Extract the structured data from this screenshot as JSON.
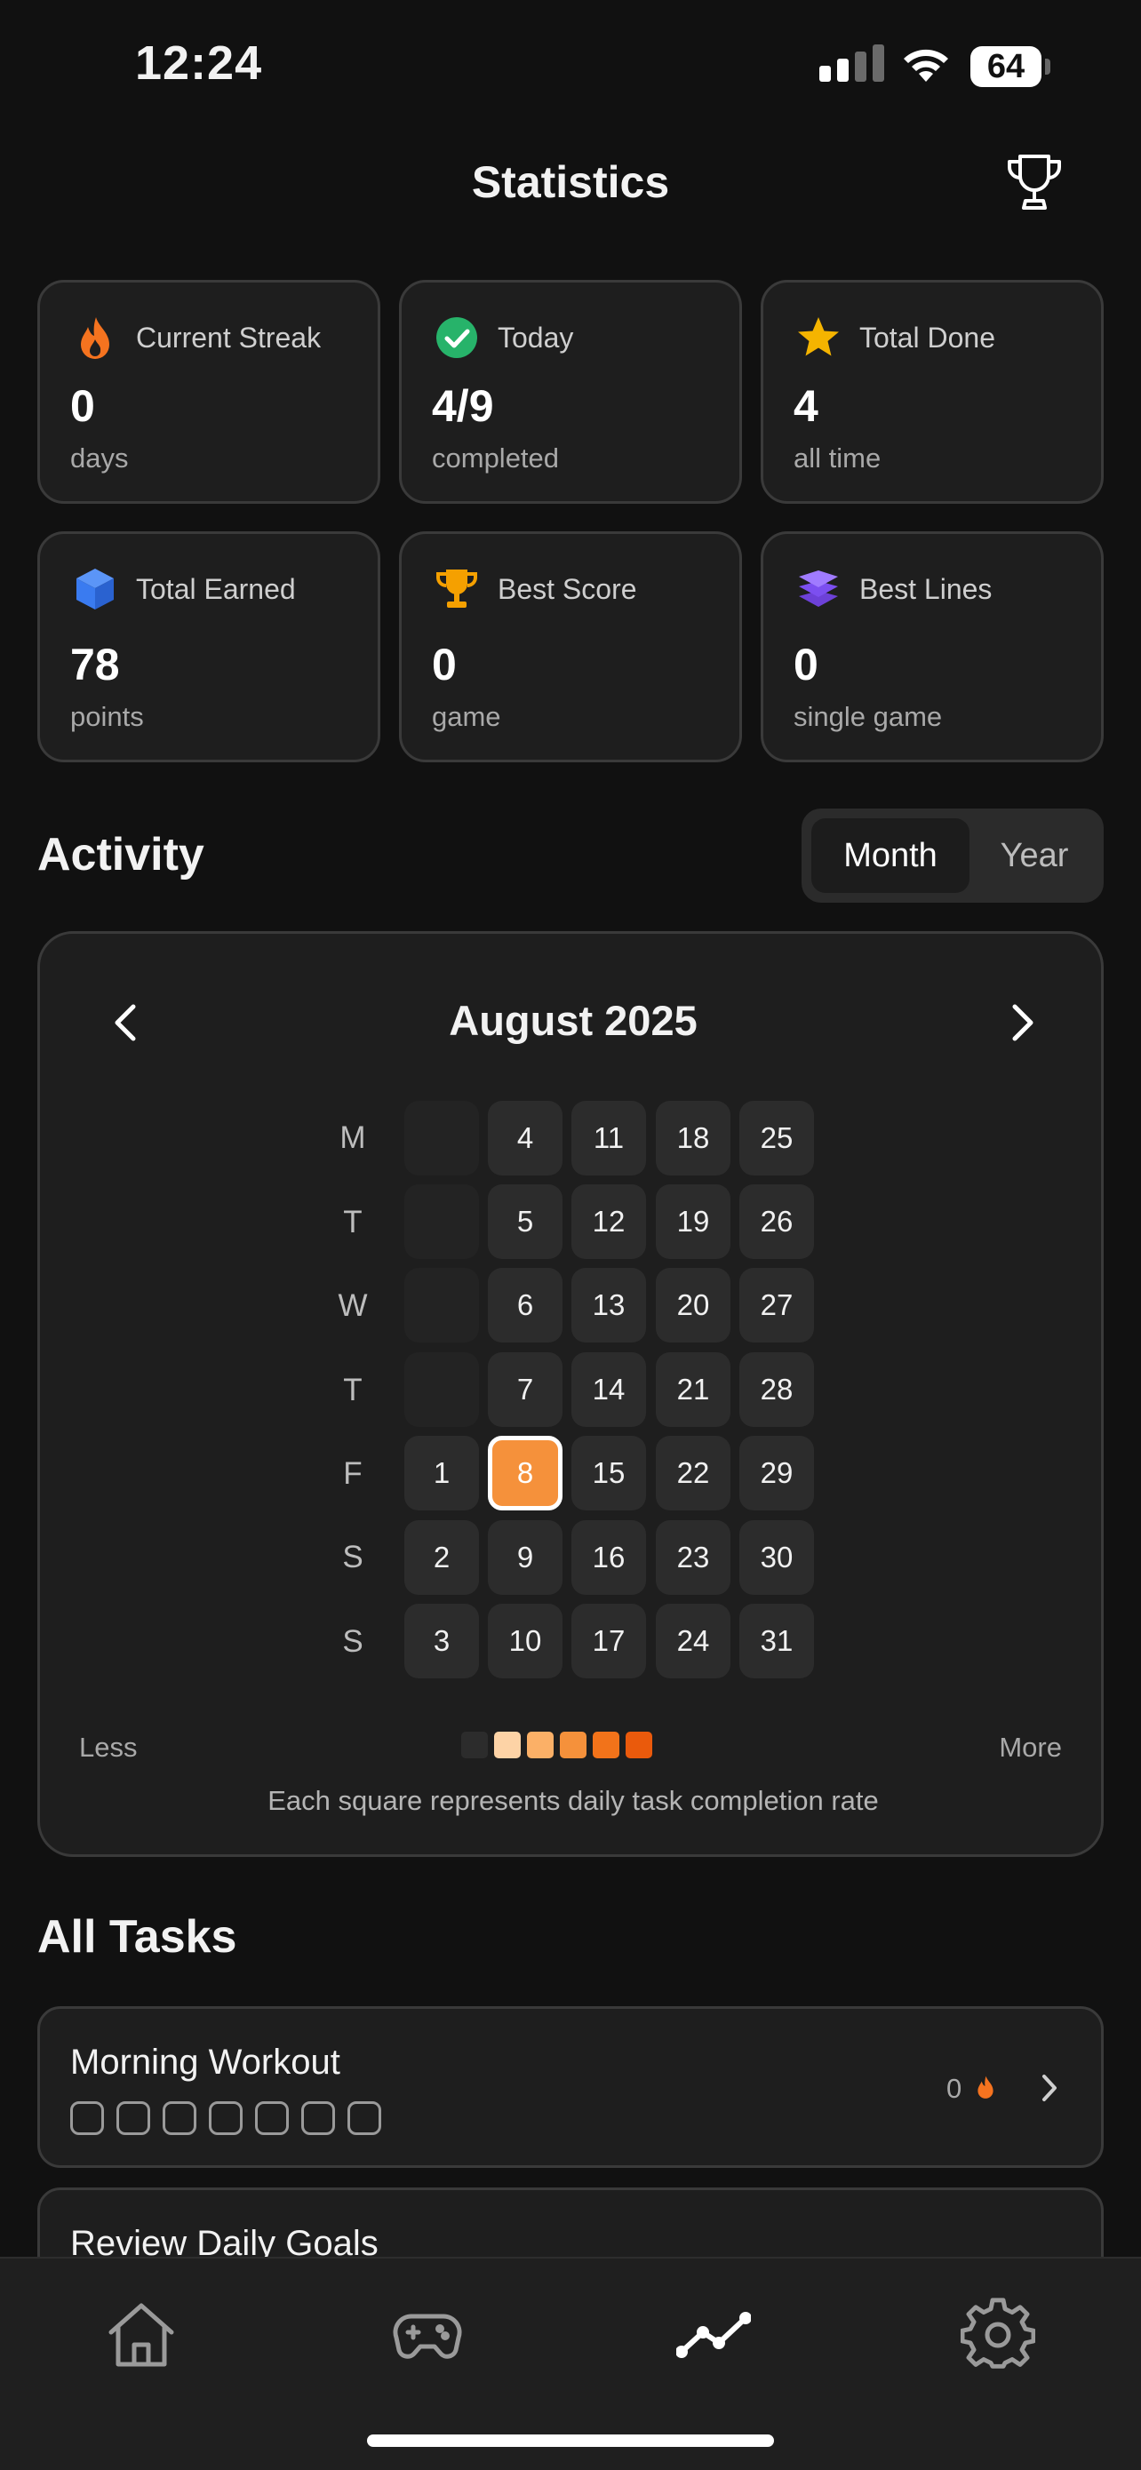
{
  "status_bar": {
    "time": "12:24",
    "battery": "64"
  },
  "header": {
    "title": "Statistics"
  },
  "stats": [
    {
      "label": "Current Streak",
      "value": "0",
      "unit": "days",
      "icon": "flame-icon",
      "color": "#f5731f"
    },
    {
      "label": "Today",
      "value": "4/9",
      "unit": "completed",
      "icon": "check-circle-icon",
      "color": "#27b36a"
    },
    {
      "label": "Total Done",
      "value": "4",
      "unit": "all time",
      "icon": "star-icon",
      "color": "#f5b400"
    },
    {
      "label": "Total Earned",
      "value": "78",
      "unit": "points",
      "icon": "cube-icon",
      "color": "#3a7bf0"
    },
    {
      "label": "Best Score",
      "value": "0",
      "unit": "game",
      "icon": "trophy-icon",
      "color": "#f5a000"
    },
    {
      "label": "Best Lines",
      "value": "0",
      "unit": "single game",
      "icon": "layers-icon",
      "color": "#8b5cf6"
    }
  ],
  "activity": {
    "title": "Activity",
    "segments": {
      "month": "Month",
      "year": "Year",
      "selected": "Month"
    },
    "month_label": "August 2025",
    "weekdays": [
      "M",
      "T",
      "W",
      "T",
      "F",
      "S",
      "S"
    ],
    "weeks": [
      [
        "",
        "",
        "",
        "",
        "1",
        "2",
        "3"
      ],
      [
        "4",
        "5",
        "6",
        "7",
        "8",
        "9",
        "10"
      ],
      [
        "11",
        "12",
        "13",
        "14",
        "15",
        "16",
        "17"
      ],
      [
        "18",
        "19",
        "20",
        "21",
        "22",
        "23",
        "24"
      ],
      [
        "25",
        "26",
        "27",
        "28",
        "29",
        "30",
        "31"
      ]
    ],
    "today": "8",
    "legend": {
      "less": "Less",
      "more": "More",
      "colors": [
        "#2c2c2c",
        "#fdd3a6",
        "#fbb067",
        "#f5913b",
        "#f2731a",
        "#ea5a0c"
      ]
    },
    "note": "Each square represents daily task completion rate"
  },
  "tasks": {
    "title": "All Tasks",
    "items": [
      {
        "name": "Morning Workout",
        "streak": "0"
      },
      {
        "name": "Review Daily Goals",
        "streak": ""
      }
    ]
  },
  "colors": {
    "accent": "#f5913b",
    "background": "#111111",
    "card": "#1e1e1e"
  }
}
